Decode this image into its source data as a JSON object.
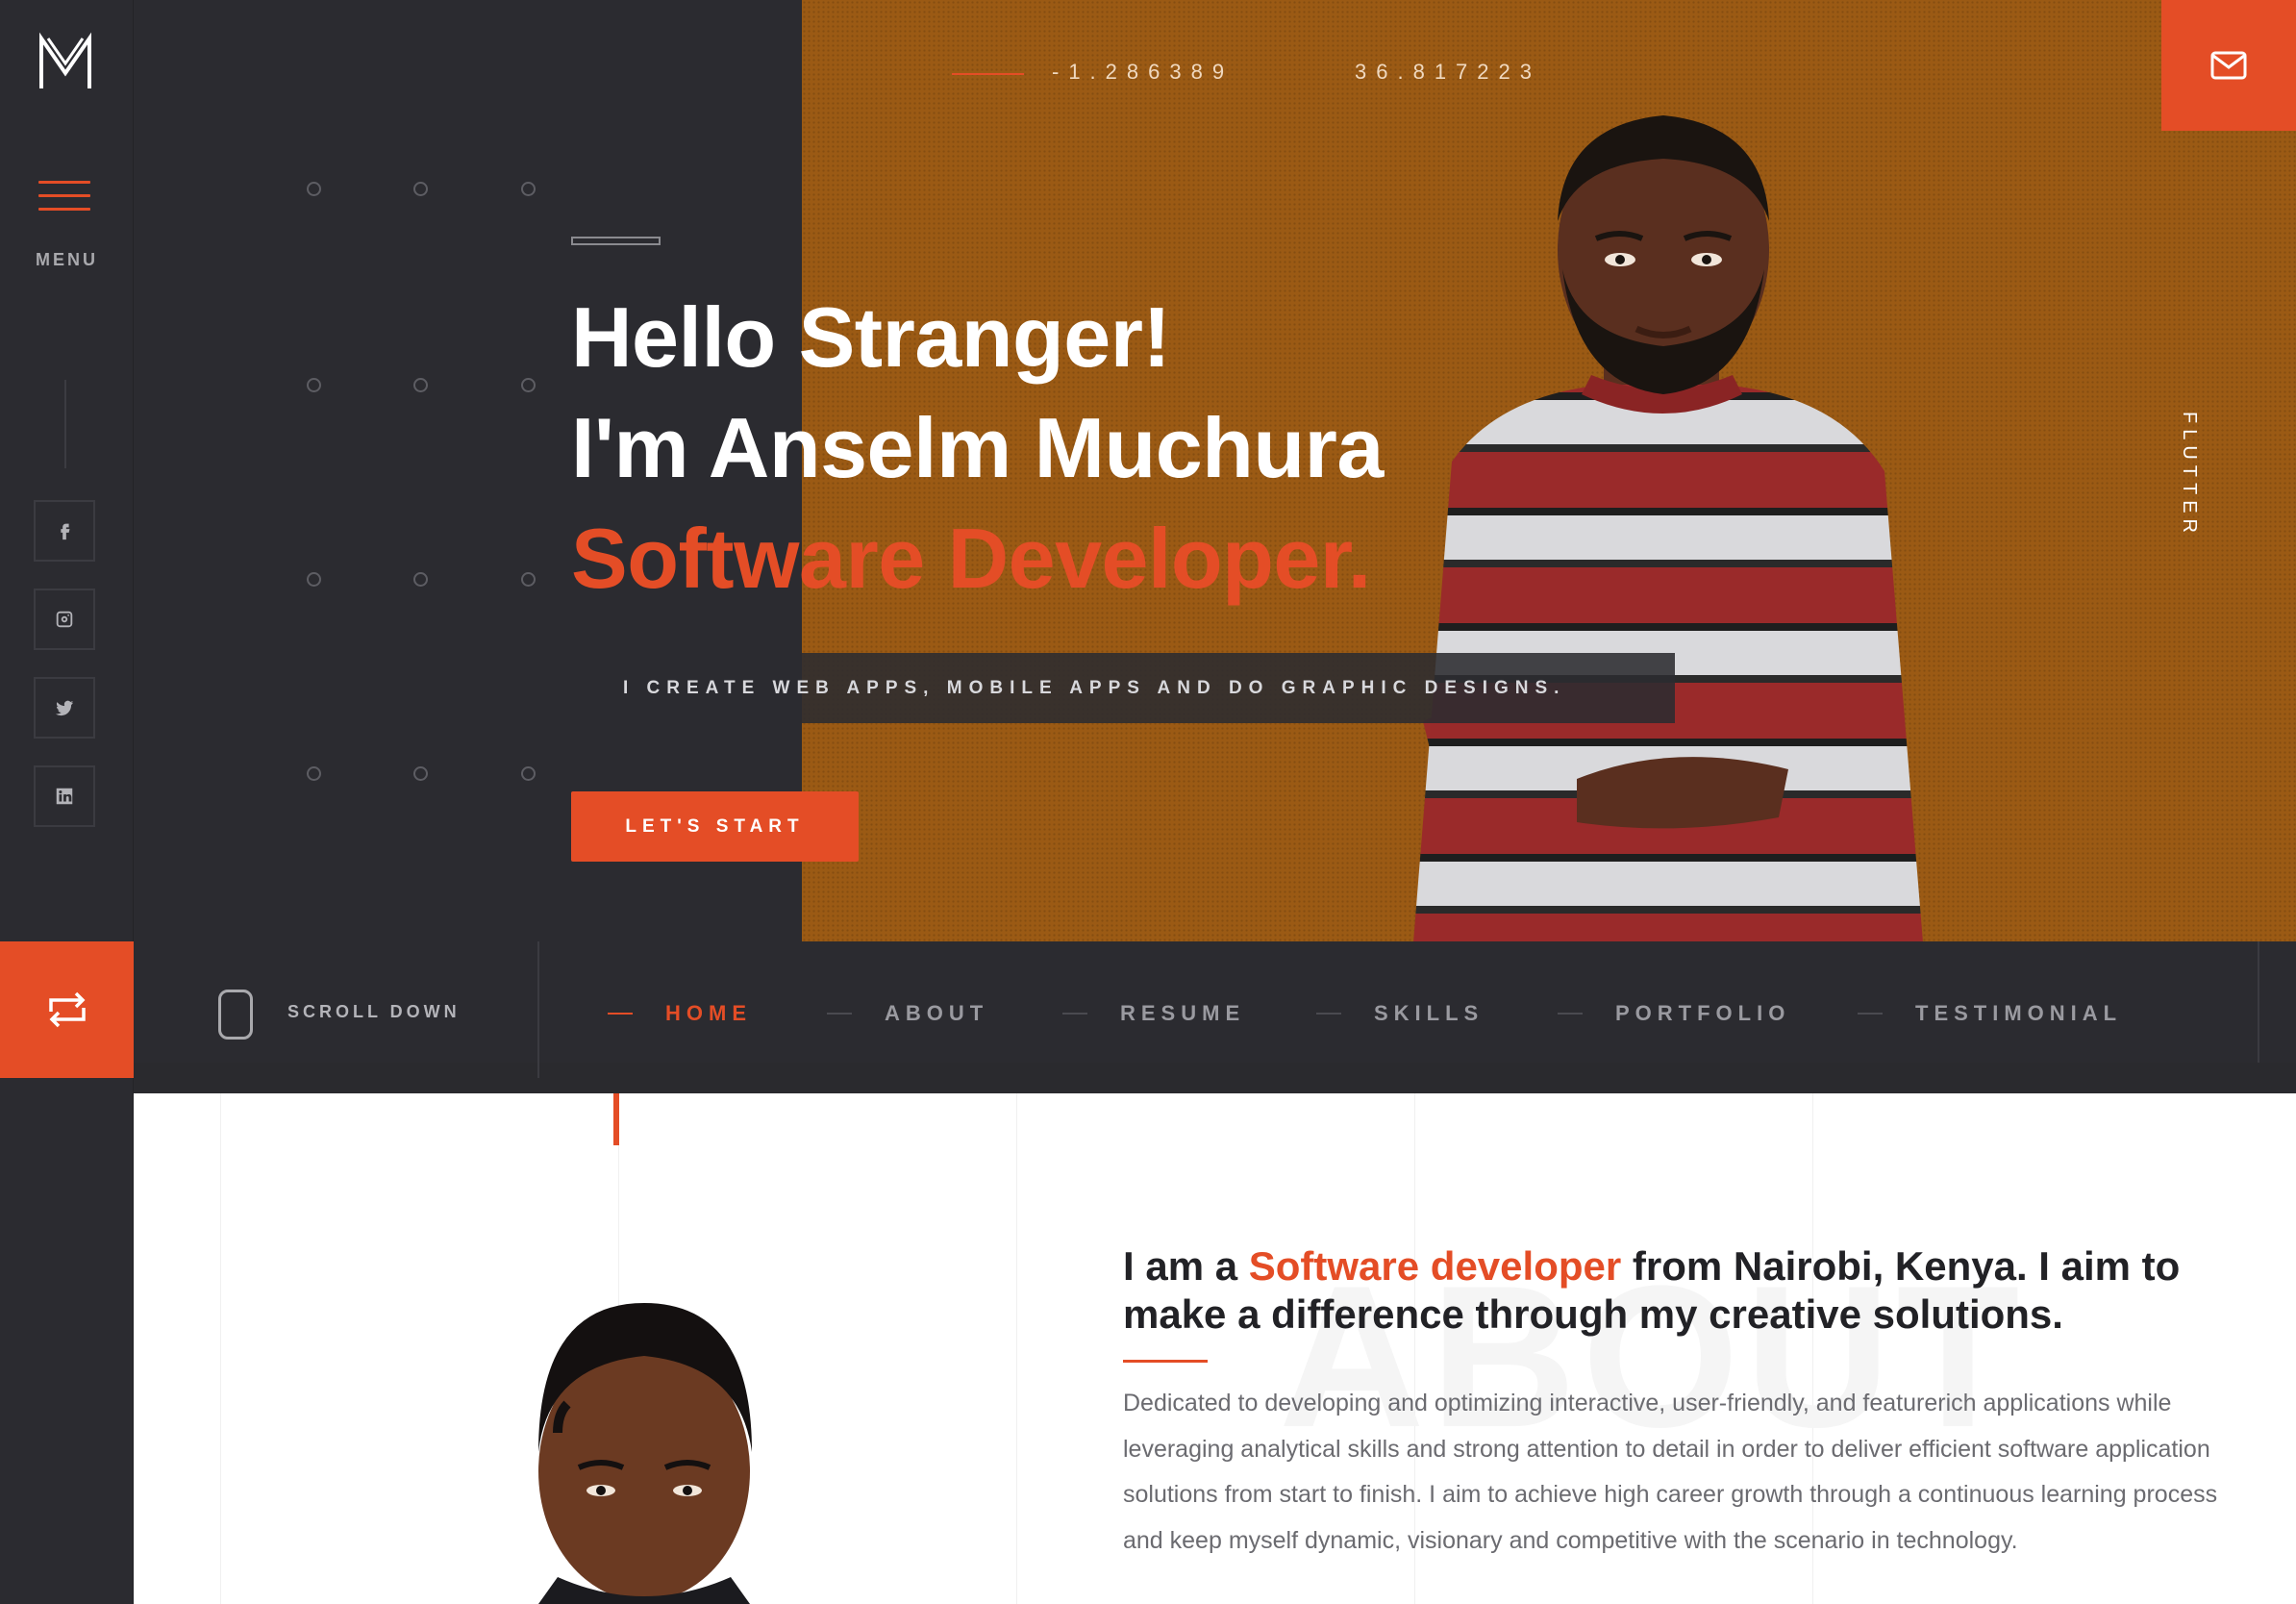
{
  "sidebar": {
    "menu_label": "MENU",
    "social": [
      {
        "name": "facebook-icon",
        "glyph": "f"
      },
      {
        "name": "instagram-icon",
        "glyph": "ig"
      },
      {
        "name": "twitter-icon",
        "glyph": "tw"
      },
      {
        "name": "linkedin-icon",
        "glyph": "in"
      }
    ]
  },
  "coordinates": {
    "latitude": "-1.286389",
    "longitude": "36.817223"
  },
  "side_text": "FLUTTER",
  "hero": {
    "line1": "Hello Stranger!",
    "line2": "I'm Anselm Muchura",
    "line3": "Software Developer.",
    "tagline": "I CREATE WEB APPS, MOBILE APPS AND DO GRAPHIC DESIGNS.",
    "cta": "LET'S START"
  },
  "navbar": {
    "scroll_label": "SCROLL DOWN",
    "items": [
      {
        "label": "HOME",
        "active": true
      },
      {
        "label": "ABOUT",
        "active": false
      },
      {
        "label": "RESUME",
        "active": false
      },
      {
        "label": "SKILLS",
        "active": false
      },
      {
        "label": "PORTFOLIO",
        "active": false
      },
      {
        "label": "TESTIMONIAL",
        "active": false
      }
    ]
  },
  "about": {
    "watermark": "ABOUT",
    "heading_pre": "I am a ",
    "heading_highlight": "Software developer",
    "heading_post": " from Nairobi, Kenya. I aim to make a difference through my creative solutions.",
    "body": "Dedicated to developing and optimizing interactive, user-friendly, and featurerich applications while leveraging analytical skills and strong attention to detail in order to deliver efficient software application solutions from start to finish. I aim to achieve high career growth through a continuous learning process and keep myself dynamic, visionary and competitive with the scenario in technology."
  },
  "colors": {
    "accent": "#e44d26",
    "dark": "#2b2b30",
    "hero_orange": "#9b5a14"
  }
}
